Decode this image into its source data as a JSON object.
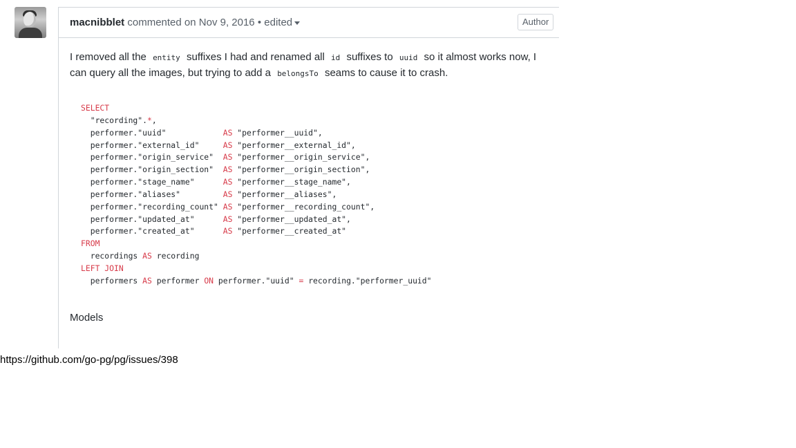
{
  "comment": {
    "author": "macnibblet",
    "action": "commented on",
    "date": "Nov 9, 2016",
    "separator": "•",
    "edited_label": "edited",
    "badge": "Author",
    "body": {
      "text1": "I removed all the",
      "code1": "entity",
      "text2": "suffixes I had and renamed all",
      "code2": "id",
      "text3": "suffixes to",
      "code3": "uuid",
      "text4": "so it almost works now, I can query all the images, but trying to add a",
      "code4": "belongsTo",
      "text5": "seams to cause it to crash."
    },
    "code_lines": [
      [
        {
          "t": "SELECT",
          "k": true
        }
      ],
      [
        {
          "t": "  \"recording\"."
        },
        {
          "t": "*",
          "k": true
        },
        {
          "t": ","
        }
      ],
      [
        {
          "t": "  performer.\"uuid\"            "
        },
        {
          "t": "AS",
          "k": true
        },
        {
          "t": " \"performer__uuid\","
        }
      ],
      [
        {
          "t": "  performer.\"external_id\"     "
        },
        {
          "t": "AS",
          "k": true
        },
        {
          "t": " \"performer__external_id\","
        }
      ],
      [
        {
          "t": "  performer.\"origin_service\"  "
        },
        {
          "t": "AS",
          "k": true
        },
        {
          "t": " \"performer__origin_service\","
        }
      ],
      [
        {
          "t": "  performer.\"origin_section\"  "
        },
        {
          "t": "AS",
          "k": true
        },
        {
          "t": " \"performer__origin_section\","
        }
      ],
      [
        {
          "t": "  performer.\"stage_name\"      "
        },
        {
          "t": "AS",
          "k": true
        },
        {
          "t": " \"performer__stage_name\","
        }
      ],
      [
        {
          "t": "  performer.\"aliases\"         "
        },
        {
          "t": "AS",
          "k": true
        },
        {
          "t": " \"performer__aliases\","
        }
      ],
      [
        {
          "t": "  performer.\"recording_count\" "
        },
        {
          "t": "AS",
          "k": true
        },
        {
          "t": " \"performer__recording_count\","
        }
      ],
      [
        {
          "t": "  performer.\"updated_at\"      "
        },
        {
          "t": "AS",
          "k": true
        },
        {
          "t": " \"performer__updated_at\","
        }
      ],
      [
        {
          "t": "  performer.\"created_at\"      "
        },
        {
          "t": "AS",
          "k": true
        },
        {
          "t": " \"performer__created_at\""
        }
      ],
      [
        {
          "t": "FROM",
          "k": true
        }
      ],
      [
        {
          "t": "  recordings "
        },
        {
          "t": "AS",
          "k": true
        },
        {
          "t": " recording"
        }
      ],
      [
        {
          "t": "LEFT JOIN",
          "k": true
        }
      ],
      [
        {
          "t": "  performers "
        },
        {
          "t": "AS",
          "k": true
        },
        {
          "t": " performer "
        },
        {
          "t": "ON",
          "k": true
        },
        {
          "t": " performer.\"uuid\" "
        },
        {
          "t": "=",
          "k": true
        },
        {
          "t": " recording.\"performer_uuid\""
        }
      ]
    ],
    "models_heading": "Models"
  },
  "source_url": "https://github.com/go-pg/pg/issues/398",
  "colors": {
    "keyword": "#d73a49",
    "text": "#24292e",
    "muted": "#586069",
    "border": "#d1d5da"
  }
}
